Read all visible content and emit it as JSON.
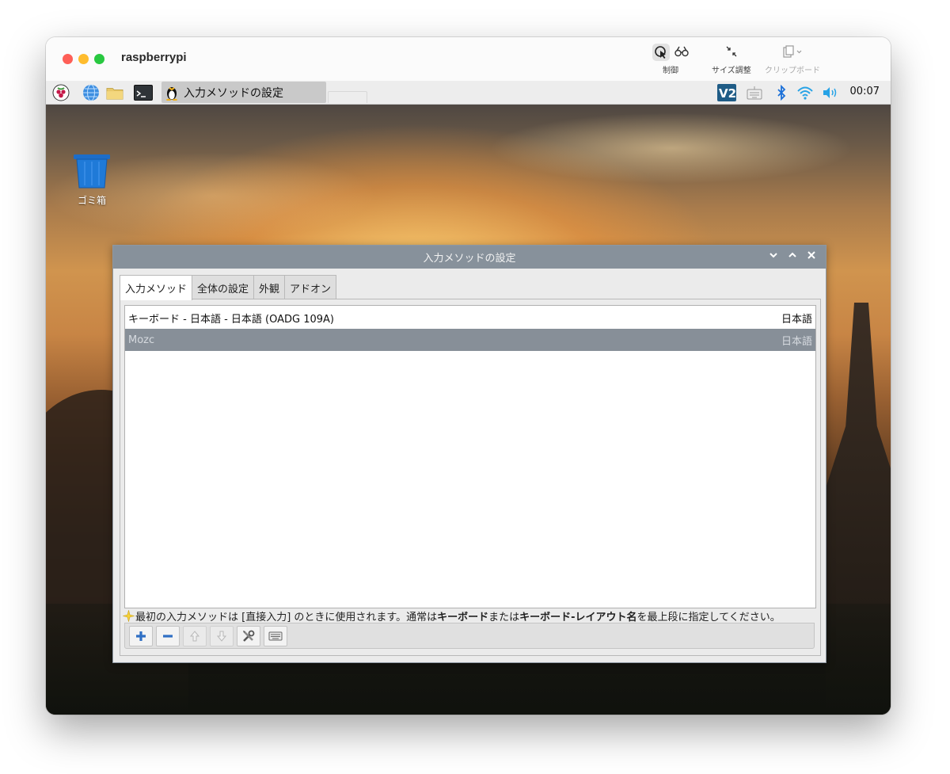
{
  "host_window": {
    "title": "raspberrypi",
    "toolbar": [
      {
        "name": "control",
        "label": "制御"
      },
      {
        "name": "resize",
        "label": "サイズ調整"
      },
      {
        "name": "clipboard",
        "label": "クリップボード"
      }
    ]
  },
  "taskbar": {
    "active_task": "入力メソッドの設定",
    "clock": "00:07",
    "icons": [
      "raspberry-menu-icon",
      "browser-globe-icon",
      "file-manager-folder-icon",
      "terminal-icon",
      "vnc-icon",
      "keyboard-icon",
      "bluetooth-icon",
      "wifi-icon",
      "volume-icon"
    ]
  },
  "desktop": {
    "trash_label": "ゴミ箱"
  },
  "dialog": {
    "title": "入力メソッドの設定",
    "tabs": [
      "入力メソッド",
      "全体の設定",
      "外観",
      "アドオン"
    ],
    "active_tab": 0,
    "input_methods": [
      {
        "name": "キーボード - 日本語 - 日本語 (OADG 109A)",
        "language": "日本語",
        "selected": false
      },
      {
        "name": "Mozc",
        "language": "日本語",
        "selected": true
      }
    ],
    "hint": {
      "p1": "最初の入力メソッドは [直接入力] のときに使用されます。通常は ",
      "b1": "キーボード",
      "p2": " または ",
      "b2": "キーボード-レイアウト名",
      "p3": " を最上段に指定してください。"
    },
    "toolbar_buttons": [
      "add",
      "remove",
      "move-up",
      "move-down",
      "configure",
      "keyboard-layout"
    ]
  },
  "colors": {
    "dialog_title_bar": "#87919b",
    "selected_row": "#878f98",
    "add_button": "#2f6fc4",
    "remove_button": "#2f6fc4"
  }
}
